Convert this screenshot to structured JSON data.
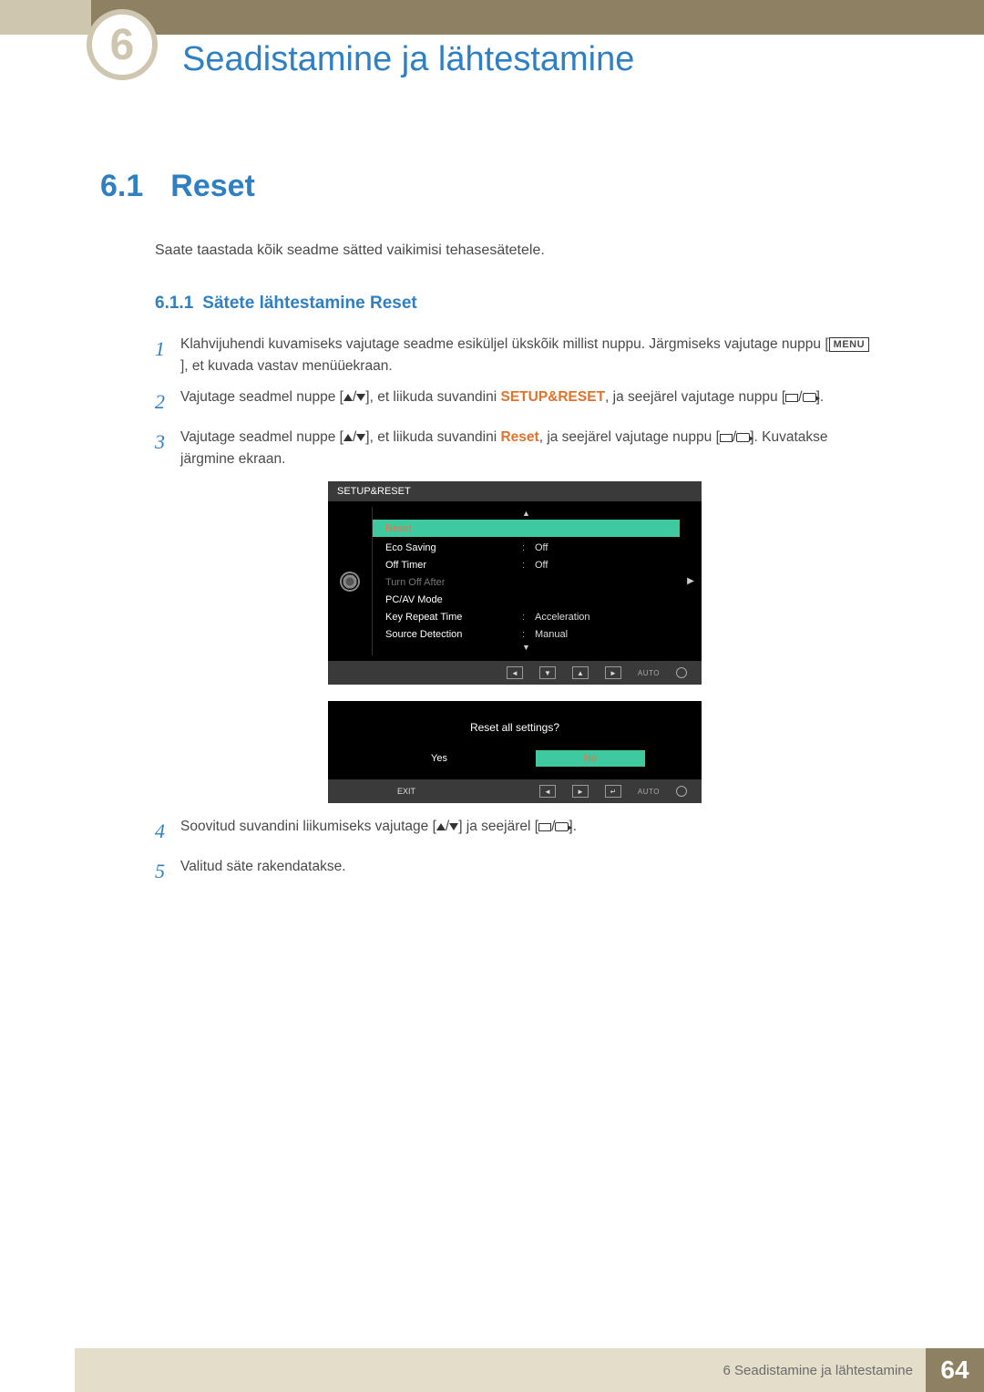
{
  "chapter": {
    "number": "6",
    "title": "Seadistamine ja lähtestamine"
  },
  "section": {
    "number": "6.1",
    "title": "Reset"
  },
  "intro": "Saate taastada kõik seadme sätted vaikimisi tehasesätetele.",
  "subsection": {
    "number": "6.1.1",
    "title": "Sätete lähtestamine Reset"
  },
  "menu_label": "MENU",
  "steps": {
    "s1": {
      "num": "1",
      "text_a": "Klahvijuhendi kuvamiseks vajutage seadme esiküljel ükskõik millist nuppu. Järgmiseks vajutage nuppu [",
      "text_b": "], et kuvada vastav menüüekraan."
    },
    "s2": {
      "num": "2",
      "text_a": "Vajutage seadmel nuppe [",
      "text_b": "], et liikuda suvandini ",
      "keyword": "SETUP&RESET",
      "text_c": ", ja seejärel vajutage nuppu [",
      "text_d": "]."
    },
    "s3": {
      "num": "3",
      "text_a": "Vajutage seadmel nuppe [",
      "text_b": "], et liikuda suvandini ",
      "keyword": "Reset",
      "text_c": ", ja seejärel vajutage nuppu [",
      "text_d": "]. Kuvatakse järgmine ekraan."
    },
    "s4": {
      "num": "4",
      "text_a": "Soovitud suvandini liikumiseks vajutage [",
      "text_b": "] ja seejärel [",
      "text_c": "]."
    },
    "s5": {
      "num": "5",
      "text": "Valitud säte rakendatakse."
    }
  },
  "osd": {
    "title": "SETUP&RESET",
    "items": [
      {
        "label": "Reset",
        "value": "",
        "highlight": true
      },
      {
        "label": "Eco Saving",
        "value": "Off"
      },
      {
        "label": "Off Timer",
        "value": "Off"
      },
      {
        "label": "Turn Off After",
        "value": "",
        "dim": true
      },
      {
        "label": "PC/AV Mode",
        "value": ""
      },
      {
        "label": "Key Repeat Time",
        "value": "Acceleration"
      },
      {
        "label": "Source Detection",
        "value": "Manual"
      }
    ],
    "footer_auto": "AUTO"
  },
  "osd_confirm": {
    "question": "Reset all settings?",
    "yes": "Yes",
    "no": "No",
    "exit": "EXIT",
    "auto": "AUTO"
  },
  "footer": {
    "chapter_text": "6 Seadistamine ja lähtestamine",
    "page": "64"
  }
}
